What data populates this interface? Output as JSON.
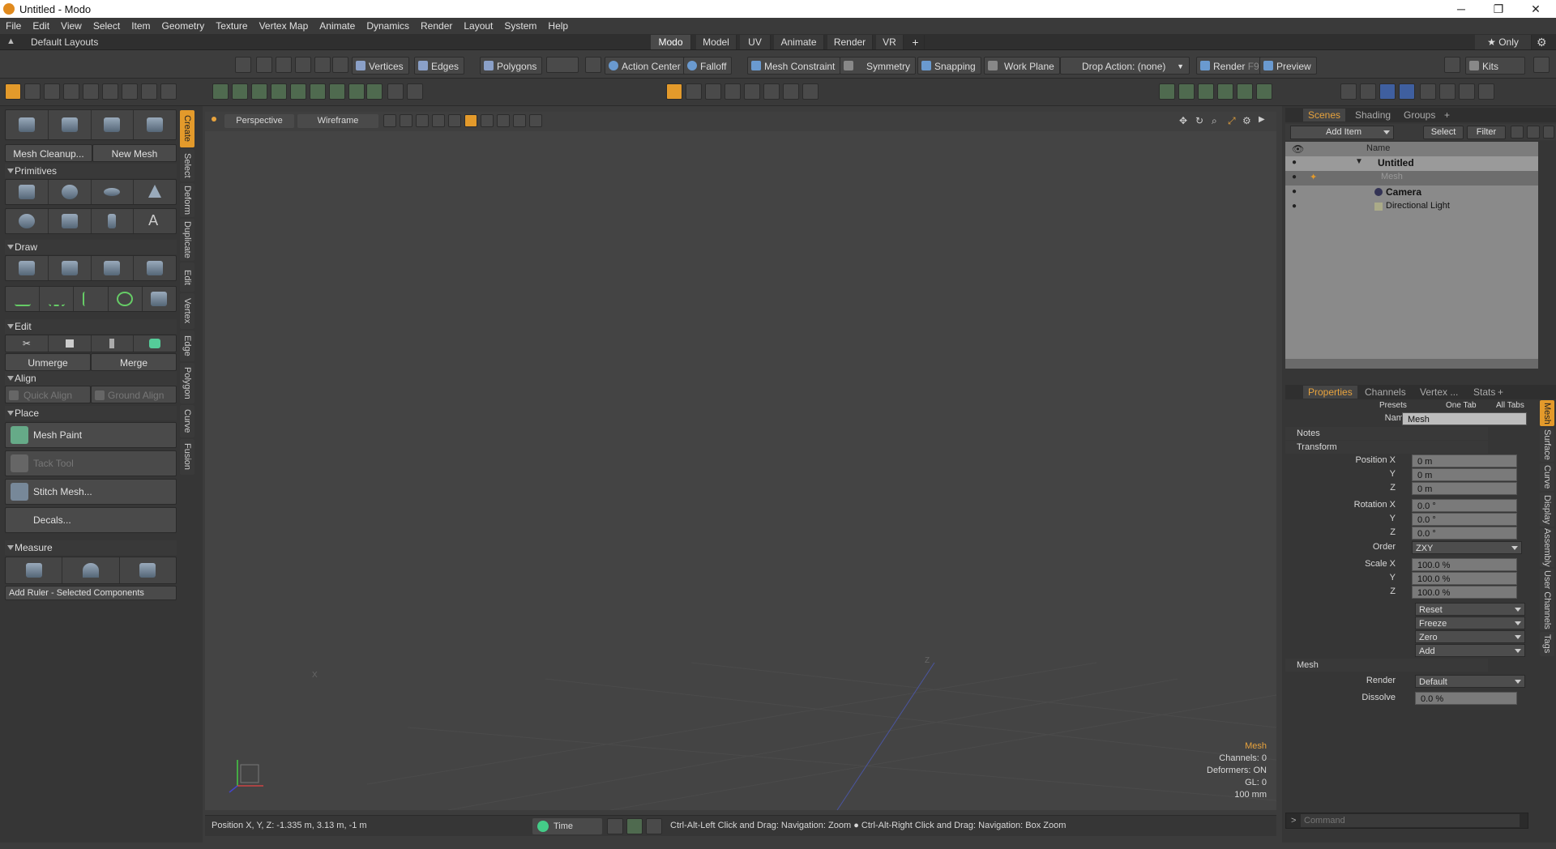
{
  "window": {
    "title": "Untitled - Modo",
    "minimize": "─",
    "maximize": "❐",
    "close": "✕"
  },
  "menu": [
    "File",
    "Edit",
    "View",
    "Select",
    "Item",
    "Geometry",
    "Texture",
    "Vertex Map",
    "Animate",
    "Dynamics",
    "Render",
    "Layout",
    "System",
    "Help"
  ],
  "layout_bar": {
    "preset": "Default Layouts",
    "tabs": [
      "Modo",
      "Model",
      "UV",
      "Animate",
      "Render",
      "VR"
    ],
    "active_tab": "Modo",
    "add": "+",
    "only_label": "★ Only"
  },
  "toolbar": {
    "vertices": "Vertices",
    "edges": "Edges",
    "polygons": "Polygons",
    "action_center": "Action Center",
    "falloff": "Falloff",
    "mesh_constraint": "Mesh Constraint",
    "symmetry": "Symmetry",
    "snapping": "Snapping",
    "work_plane": "Work Plane",
    "drop_action": "Drop Action: (none)",
    "render": "Render",
    "render_key": "F9",
    "preview": "Preview",
    "kits": "Kits"
  },
  "left": {
    "mesh_cleanup": "Mesh Cleanup...",
    "new_mesh": "New Mesh",
    "primitives": "Primitives",
    "draw": "Draw",
    "edit": "Edit",
    "unmerge": "Unmerge",
    "merge": "Merge",
    "align": "Align",
    "quick_align": "Quick Align",
    "ground_align": "Ground Align",
    "place": "Place",
    "mesh_paint": "Mesh Paint",
    "tack_tool": "Tack Tool",
    "stitch_mesh": "Stitch Mesh...",
    "decals": "Decals...",
    "measure": "Measure",
    "add_ruler": "Add Ruler - Selected Components"
  },
  "side_tabs": [
    "Create",
    "Select",
    "Deform",
    "Duplicate",
    "Edit",
    "Vertex",
    "Edge",
    "Polygon",
    "Curve",
    "Fusion"
  ],
  "viewport": {
    "view_mode": "Perspective",
    "shading": "Wireframe",
    "overlay": {
      "item": "Mesh",
      "channels": "Channels: 0",
      "deformers": "Deformers: ON",
      "gl": "GL: 0",
      "scale": "100 mm"
    },
    "axis_x": "X",
    "axis_z": "Z"
  },
  "status": {
    "position": "Position X, Y, Z:   -1.335 m, 3.13 m, -1 m",
    "time": "Time",
    "hint": "Ctrl-Alt-Left Click and Drag: Navigation: Zoom ● Ctrl-Alt-Right Click and Drag: Navigation: Box Zoom"
  },
  "scenes": {
    "tabs": [
      "Scenes",
      "Shading",
      "Groups",
      "+"
    ],
    "add_item": "Add Item",
    "select": "Select",
    "filter": "Filter",
    "name_header": "Name",
    "items": [
      {
        "name": "Untitled",
        "bold": true
      },
      {
        "name": "Mesh",
        "bold": false
      },
      {
        "name": "Camera",
        "bold": true
      },
      {
        "name": "Directional Light",
        "bold": false
      }
    ]
  },
  "properties": {
    "tabs": [
      "Properties",
      "Channels",
      "Vertex ...",
      "Stats",
      "+"
    ],
    "presets": "Presets",
    "one_tab": "One Tab",
    "all_tabs": "All Tabs",
    "name_label": "Name",
    "name_value": "Mesh",
    "notes": "Notes",
    "transform": "Transform",
    "position_x_label": "Position X",
    "y_label": "Y",
    "z_label": "Z",
    "pos_x": "0 m",
    "pos_y": "0 m",
    "pos_z": "0 m",
    "rotation_x_label": "Rotation X",
    "rot_x": "0.0 °",
    "rot_y": "0.0 °",
    "rot_z": "0.0 °",
    "order_label": "Order",
    "order_value": "ZXY",
    "scale_x_label": "Scale X",
    "scale_x": "100.0 %",
    "scale_y": "100.0 %",
    "scale_z": "100.0 %",
    "reset": "Reset",
    "freeze": "Freeze",
    "zero": "Zero",
    "add": "Add",
    "mesh_section": "Mesh",
    "render_label": "Render",
    "render_value": "Default",
    "dissolve_label": "Dissolve",
    "dissolve_value": "0.0 %",
    "command_placeholder": "Command"
  },
  "prop_side_tabs": [
    "Mesh",
    "Surface",
    "Curve",
    "Display",
    "Assembly",
    "User Channels",
    "Tags"
  ],
  "colors": {
    "accent": "#e8a33d",
    "panel": "#363636",
    "viewport": "#444444"
  }
}
